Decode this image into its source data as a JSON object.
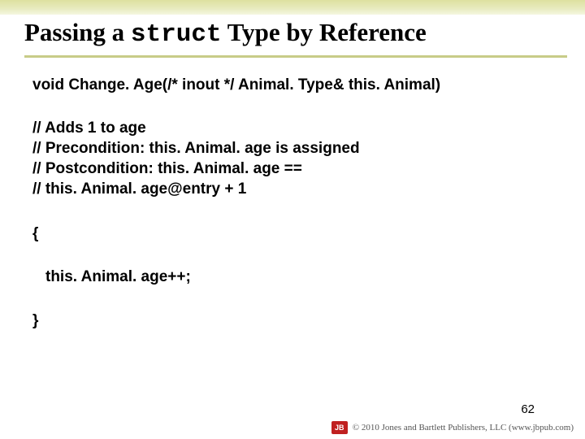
{
  "title": {
    "prefix": "Passing a ",
    "mono": "struct",
    "suffix": " Type by Reference"
  },
  "signature": "void Change. Age(/* inout */ Animal. Type& this. Animal)",
  "comments": [
    "// Adds 1 to age",
    "// Precondition: this. Animal. age is assigned",
    "// Postcondition: this. Animal. age ==",
    "//   this. Animal. age@entry + 1"
  ],
  "brace_open": "{",
  "body_line": "this. Animal. age++;",
  "brace_close": "}",
  "page_number": "62",
  "footer": {
    "logo_text": "JB",
    "credit": "© 2010 Jones and Bartlett Publishers, LLC (www.jbpub.com)"
  }
}
